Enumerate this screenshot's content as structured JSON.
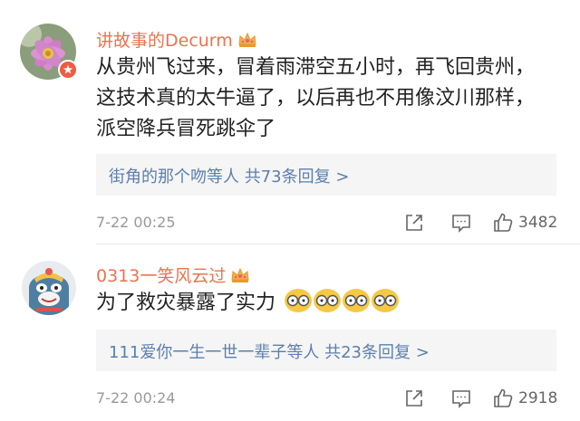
{
  "comments": [
    {
      "username": "讲故事的Decurm",
      "text_lines": [
        "从贵州飞过来，冒着雨滞空五小时，再飞回贵州，",
        "这技术真的太牛逼了，以后再也不用像汶川那样，",
        "派空降兵冒死跳伞了"
      ],
      "reply_summary": "街角的那个吻等人 共73条回复 >",
      "time": "7-22 00:25",
      "likes": "3482",
      "avatar": "pink-flower-avatar",
      "badge": "verified-badge-icon"
    },
    {
      "username": "0313一笑风云过",
      "text": "为了救灾暴露了实力",
      "emoji": "glasses-face-emoji",
      "reply_summary": "111爱你一生一世一辈子等人 共23条回复 >",
      "time": "7-22 00:24",
      "likes": "2918",
      "avatar": "cartoon-cat-avatar"
    }
  ],
  "icons": {
    "share": "share-icon",
    "comment": "comment-icon",
    "like": "thumbs-up-icon",
    "crown": "vip-crown-icon"
  },
  "colors": {
    "username": "#eb7350",
    "reply_link": "#5b7fae",
    "reply_bg": "#f5f5f5",
    "meta": "#999999"
  }
}
